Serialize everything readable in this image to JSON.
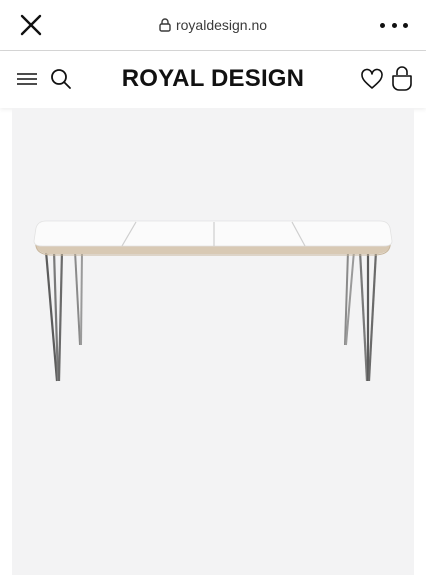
{
  "browser": {
    "url": "royaldesign.no",
    "icons": {
      "close": "close-icon",
      "lock": "lock-icon",
      "more": "more-icon"
    }
  },
  "header": {
    "logo_text": "ROYAL DESIGN",
    "icons": {
      "menu": "menu-icon",
      "search": "search-icon",
      "wishlist": "heart-icon",
      "cart": "bag-icon"
    }
  },
  "product": {
    "image": "extendable-white-table-with-chrome-legs",
    "background_color": "#f3f3f4"
  }
}
